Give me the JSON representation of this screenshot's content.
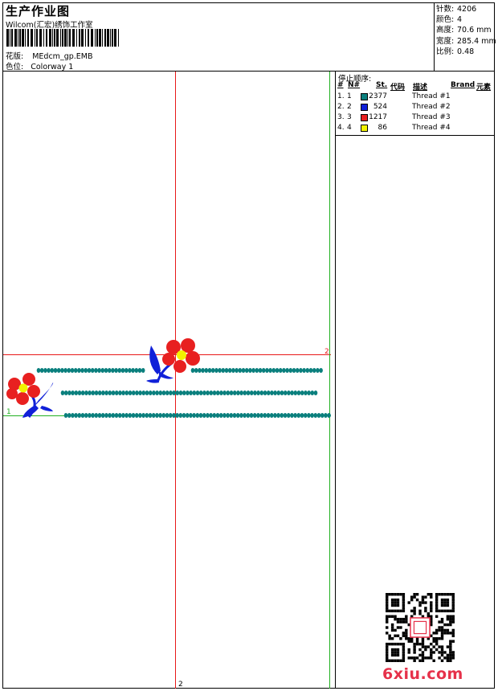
{
  "header": {
    "title": "生产作业图",
    "company": "Wilcom(汇宏)绣饰工作室",
    "design_label": "花版:",
    "design_value": "MEdcm_gp.EMB",
    "colorway_label": "色位:",
    "colorway_value": "Colorway 1"
  },
  "stats": [
    {
      "label": "针数:",
      "value": "4206"
    },
    {
      "label": "颜色:",
      "value": "4"
    },
    {
      "label": "高度:",
      "value": "70.6 mm"
    },
    {
      "label": "宽度:",
      "value": "285.4 mm"
    },
    {
      "label": "比例:",
      "value": "0.48"
    }
  ],
  "sequence": {
    "heading": "停止顺序:",
    "columns": {
      "num": "#",
      "n": "N#",
      "st": "St.",
      "code": "代码",
      "desc": "描述",
      "brand": "Brand",
      "element": "元素"
    },
    "rows": [
      {
        "num": "1.",
        "n": "1",
        "color": "#0a7f7d",
        "st": "2377",
        "desc": "Thread #1"
      },
      {
        "num": "2.",
        "n": "2",
        "color": "#1020d8",
        "st": "524",
        "desc": "Thread #2"
      },
      {
        "num": "3.",
        "n": "3",
        "color": "#e82020",
        "st": "1217",
        "desc": "Thread #3"
      },
      {
        "num": "4.",
        "n": "4",
        "color": "#f2f200",
        "st": "86",
        "desc": "Thread #4"
      }
    ]
  },
  "axes": {
    "green_label": "1",
    "red_h_label": "2",
    "red_v_label": "2"
  },
  "watermark": {
    "text": "6xiu.com"
  },
  "colors": {
    "teal": "#0a7f7d",
    "blue": "#1020d8",
    "red": "#e82020",
    "yellow": "#f2f200",
    "guide_red": "#e81818",
    "guide_green": "#22b022"
  }
}
